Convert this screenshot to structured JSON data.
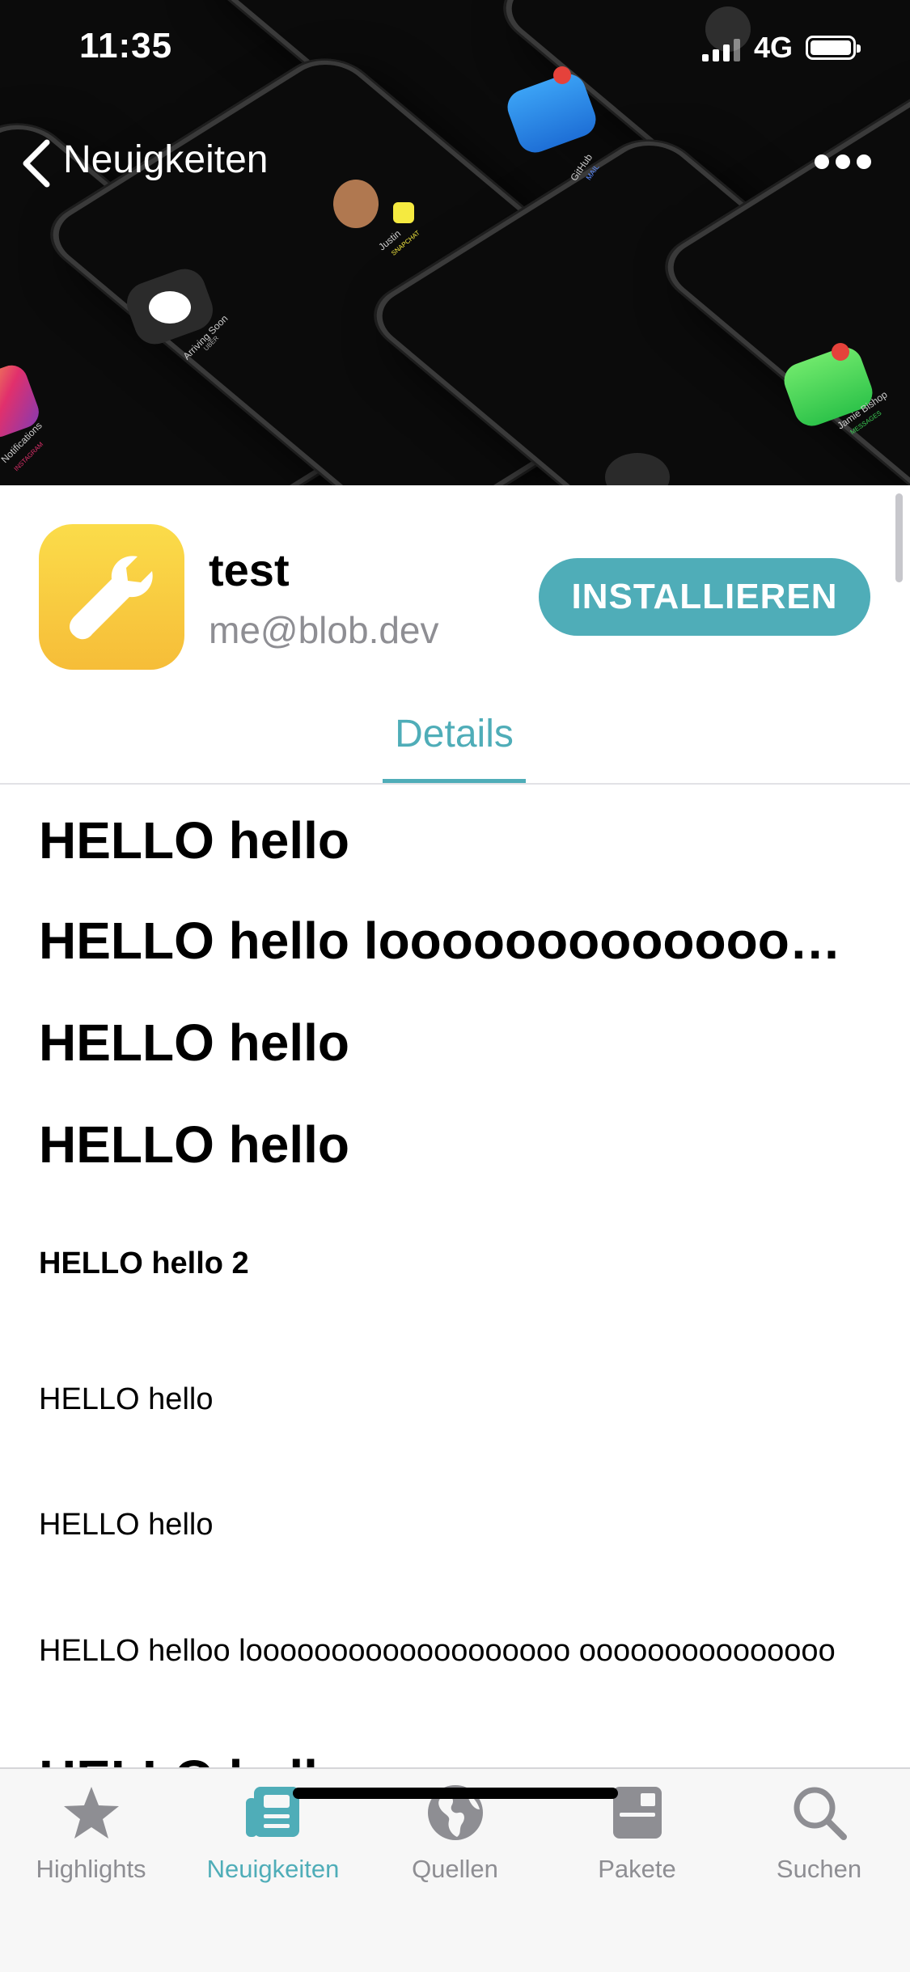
{
  "status_bar": {
    "time": "11:35",
    "network": "4G"
  },
  "nav": {
    "back_label": "Neuigkeiten"
  },
  "hero": {
    "labels": [
      "Arriving Soon",
      "UBER",
      "Justin",
      "SNAPCHAT",
      "GitHub",
      "MAIL",
      "Jamie Bishop",
      "MESSAGES",
      "Notifications",
      "INSTAGRAM"
    ]
  },
  "app": {
    "name": "test",
    "author": "me@blob.dev",
    "install_label": "INSTALLIEREN"
  },
  "tabs": {
    "details_label": "Details"
  },
  "content": {
    "lines": [
      "HELLO hello",
      "HELLO hello loooooooooooooooooooooo",
      "HELLO hello",
      "HELLO hello",
      "HELLO hello 2",
      "HELLO hello",
      "HELLO hello",
      "HELLO helloo looooooooooooooooooo ooooooooooooooo",
      "HELLO hello"
    ]
  },
  "tab_bar": {
    "items": [
      {
        "label": "Highlights",
        "icon": "star-icon"
      },
      {
        "label": "Neuigkeiten",
        "icon": "news-icon"
      },
      {
        "label": "Quellen",
        "icon": "globe-icon"
      },
      {
        "label": "Pakete",
        "icon": "package-icon"
      },
      {
        "label": "Suchen",
        "icon": "search-icon"
      }
    ],
    "active": "Neuigkeiten"
  },
  "colors": {
    "accent": "#4fadb8",
    "icon_yellow": "#f8c93f",
    "inactive": "#8e8e93"
  }
}
